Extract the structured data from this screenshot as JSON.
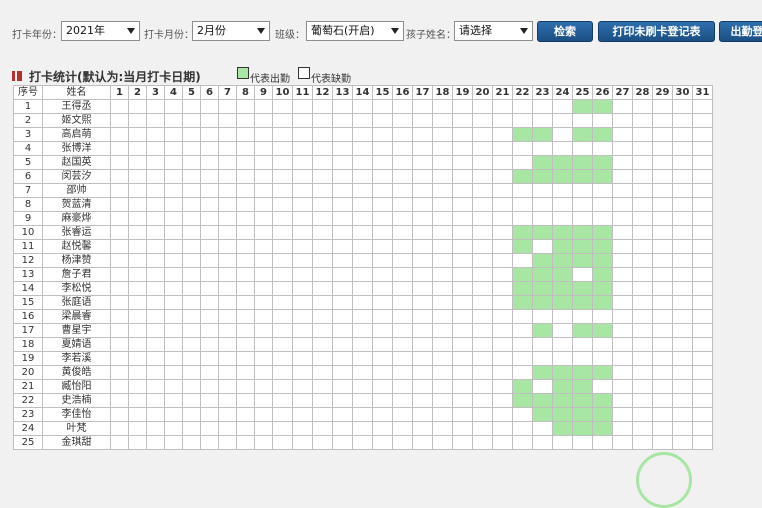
{
  "filters": {
    "year_label": "打卡年份：",
    "year_value": "2021年",
    "month_label": "打卡月份：",
    "month_value": "2月份",
    "class_label": "班级：",
    "class_value": "葡萄石(开启)",
    "child_label": "孩子姓名：",
    "child_value": "请选择"
  },
  "buttons": {
    "search": "检索",
    "print": "打印未刷卡登记表",
    "export": "出勤登"
  },
  "section": {
    "title": "打卡统计(默认为:当月打卡日期)",
    "legend_present": "代表出勤",
    "legend_absent": "代表缺勤"
  },
  "colors": {
    "present": "#a8e6a4",
    "absent": "#ffffff",
    "button": "#1f5a94"
  },
  "table": {
    "header_no": "序号",
    "header_name": "姓名",
    "days": [
      "1",
      "2",
      "3",
      "4",
      "5",
      "6",
      "7",
      "8",
      "9",
      "10",
      "11",
      "12",
      "13",
      "14",
      "15",
      "16",
      "17",
      "18",
      "19",
      "20",
      "21",
      "22",
      "23",
      "24",
      "25",
      "26",
      "27",
      "28",
      "29",
      "30",
      "31"
    ],
    "rows": [
      {
        "no": "1",
        "name": "王得丞",
        "present": [
          25,
          26
        ]
      },
      {
        "no": "2",
        "name": "姬文熙",
        "present": []
      },
      {
        "no": "3",
        "name": "高启萌",
        "present": [
          22,
          23,
          25,
          26
        ]
      },
      {
        "no": "4",
        "name": "张博洋",
        "present": []
      },
      {
        "no": "5",
        "name": "赵国英",
        "present": [
          23,
          24,
          25,
          26
        ]
      },
      {
        "no": "6",
        "name": "闵芸汐",
        "present": [
          22,
          23,
          24,
          25,
          26
        ]
      },
      {
        "no": "7",
        "name": "邵帅",
        "present": []
      },
      {
        "no": "8",
        "name": "贺蓝清",
        "present": []
      },
      {
        "no": "9",
        "name": "麻豪烨",
        "present": []
      },
      {
        "no": "10",
        "name": "张睿运",
        "present": [
          22,
          23,
          24,
          25,
          26
        ]
      },
      {
        "no": "11",
        "name": "赵悦馨",
        "present": [
          22,
          24,
          25,
          26
        ]
      },
      {
        "no": "12",
        "name": "杨津赞",
        "present": [
          23,
          24,
          25,
          26
        ]
      },
      {
        "no": "13",
        "name": "詹子君",
        "present": [
          22,
          23,
          24,
          26
        ]
      },
      {
        "no": "14",
        "name": "李松悦",
        "present": [
          22,
          23,
          24,
          25,
          26
        ]
      },
      {
        "no": "15",
        "name": "张庭语",
        "present": [
          22,
          23,
          24,
          25,
          26
        ]
      },
      {
        "no": "16",
        "name": "梁晨睿",
        "present": []
      },
      {
        "no": "17",
        "name": "曹星宇",
        "present": [
          23,
          25,
          26
        ]
      },
      {
        "no": "18",
        "name": "夏婧语",
        "present": []
      },
      {
        "no": "19",
        "name": "李若溪",
        "present": []
      },
      {
        "no": "20",
        "name": "黄俊皓",
        "present": [
          23,
          24,
          25,
          26
        ]
      },
      {
        "no": "21",
        "name": "臧怡阳",
        "present": [
          22,
          24,
          25
        ]
      },
      {
        "no": "22",
        "name": "史浩楠",
        "present": [
          22,
          23,
          24,
          25,
          26
        ]
      },
      {
        "no": "23",
        "name": "李佳怡",
        "present": [
          23,
          24,
          25,
          26
        ]
      },
      {
        "no": "24",
        "name": "叶梵",
        "present": [
          24,
          25,
          26
        ]
      },
      {
        "no": "25",
        "name": "金琪甜",
        "present": []
      }
    ]
  }
}
